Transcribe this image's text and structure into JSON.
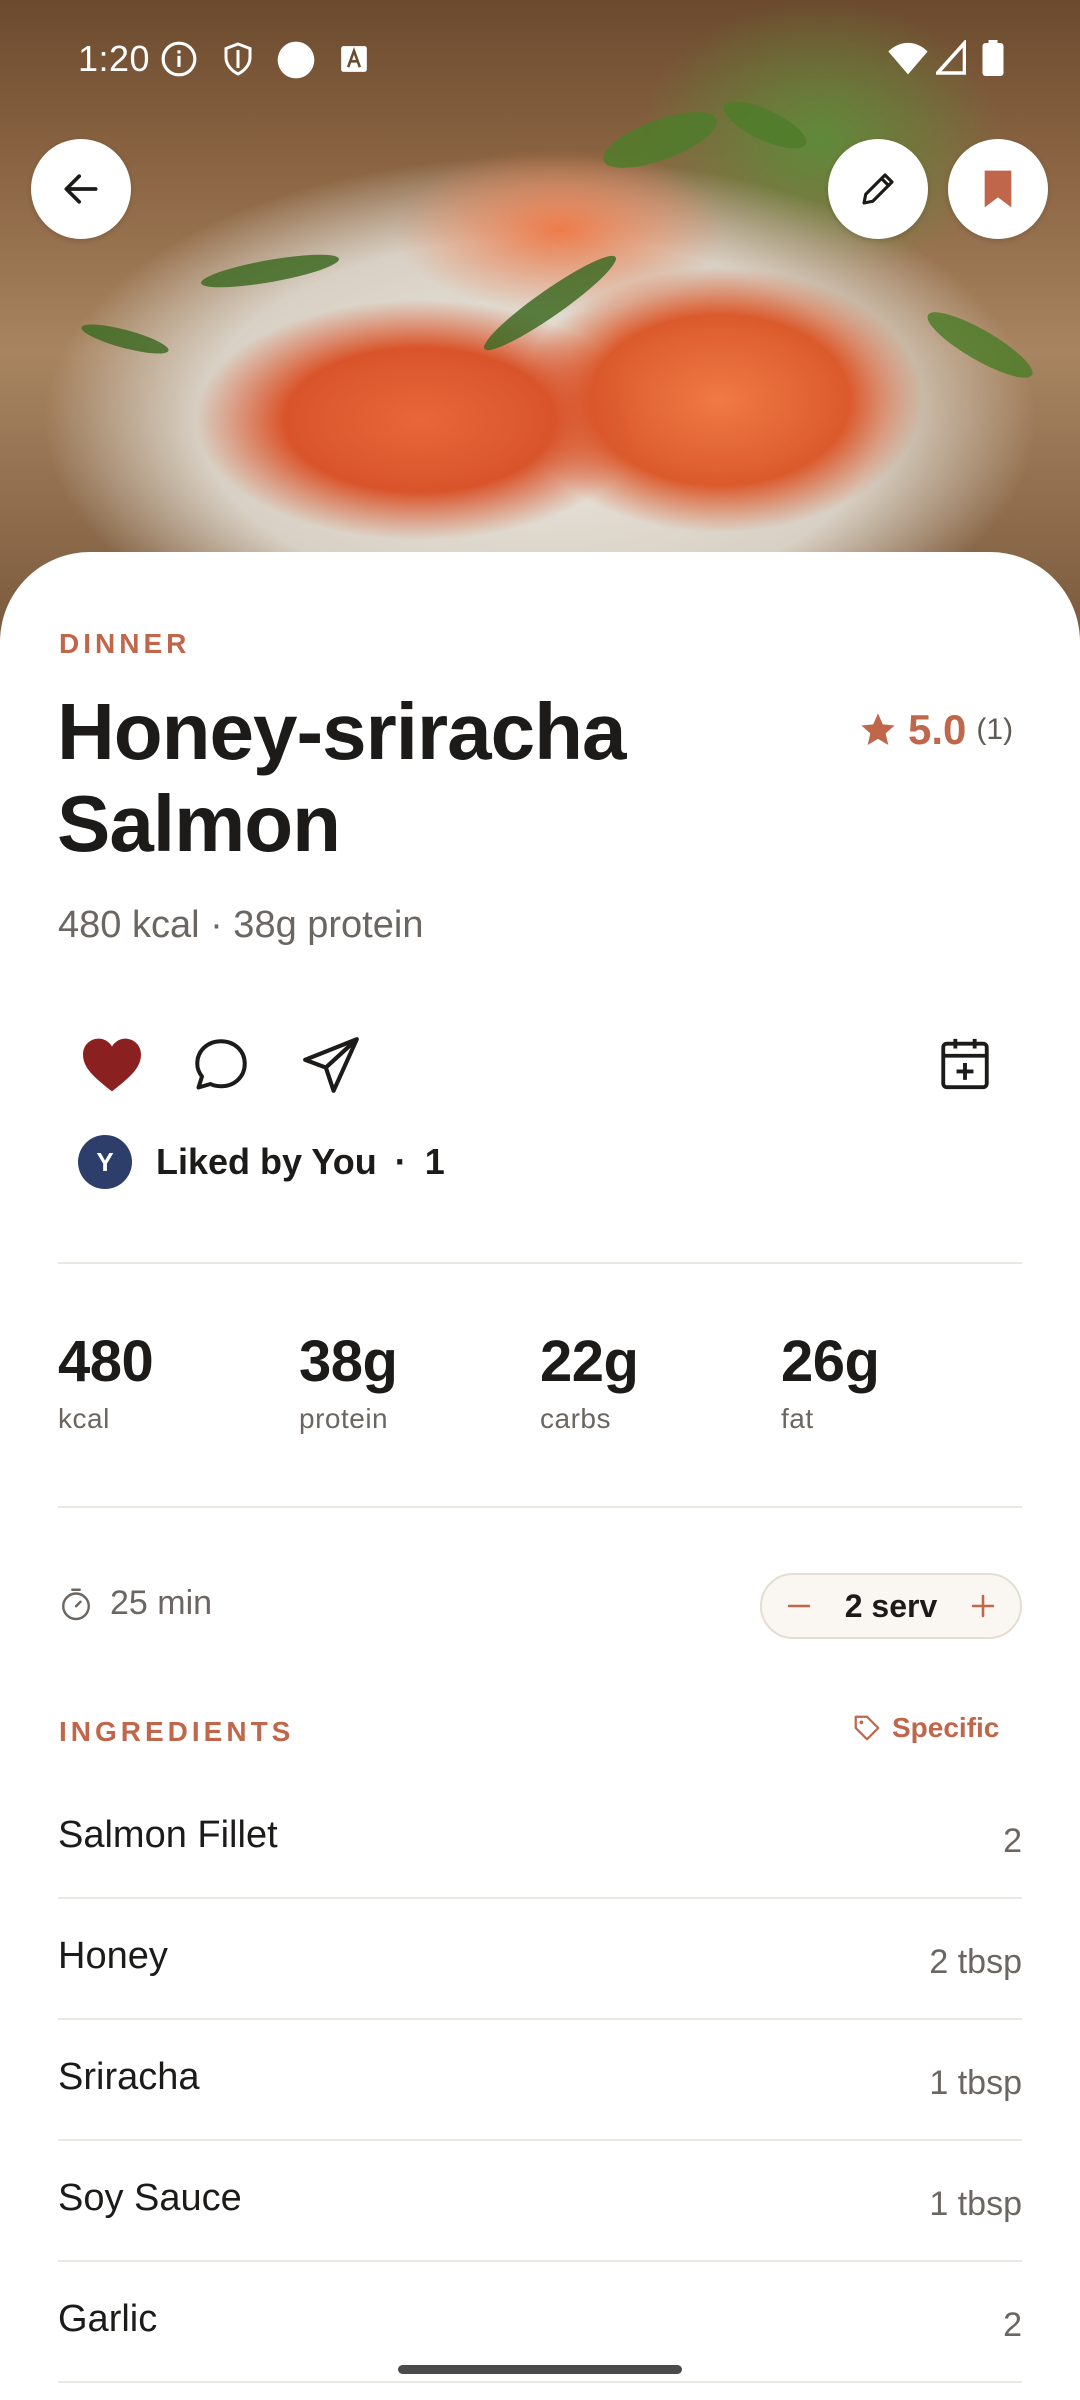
{
  "status_bar": {
    "time": "1:20"
  },
  "recipe": {
    "category": "DINNER",
    "title_line1": "Honey-sriracha",
    "title_line2": "Salmon",
    "rating": "5.0",
    "rating_count": "(1)",
    "subline": "480 kcal · 38g protein"
  },
  "social": {
    "avatar_initial": "Y",
    "liked_by": "Liked by You",
    "separator": "·",
    "like_count": "1"
  },
  "nutrition": [
    {
      "value": "480",
      "label": "kcal"
    },
    {
      "value": "38g",
      "label": "protein"
    },
    {
      "value": "22g",
      "label": "carbs"
    },
    {
      "value": "26g",
      "label": "fat"
    }
  ],
  "meta": {
    "time": "25 min",
    "servings": "2 serv"
  },
  "ingredients": {
    "header": "INGREDIENTS",
    "filter_label": "Specific",
    "items": [
      {
        "name": "Salmon Fillet",
        "qty": "2"
      },
      {
        "name": "Honey",
        "qty": "2 tbsp"
      },
      {
        "name": "Sriracha",
        "qty": "1 tbsp"
      },
      {
        "name": "Soy Sauce",
        "qty": "1 tbsp"
      },
      {
        "name": "Garlic",
        "qty": "2"
      }
    ]
  },
  "colors": {
    "accent": "#c0664a",
    "heart": "#8b2020",
    "bookmark": "#c0664a",
    "avatar": "#2e3e6a"
  },
  "icons": [
    "back-arrow-icon",
    "pencil-icon",
    "bookmark-icon",
    "heart-icon",
    "comment-icon",
    "send-icon",
    "calendar-add-icon",
    "star-icon",
    "timer-icon",
    "minus-icon",
    "plus-icon",
    "tag-icon"
  ]
}
